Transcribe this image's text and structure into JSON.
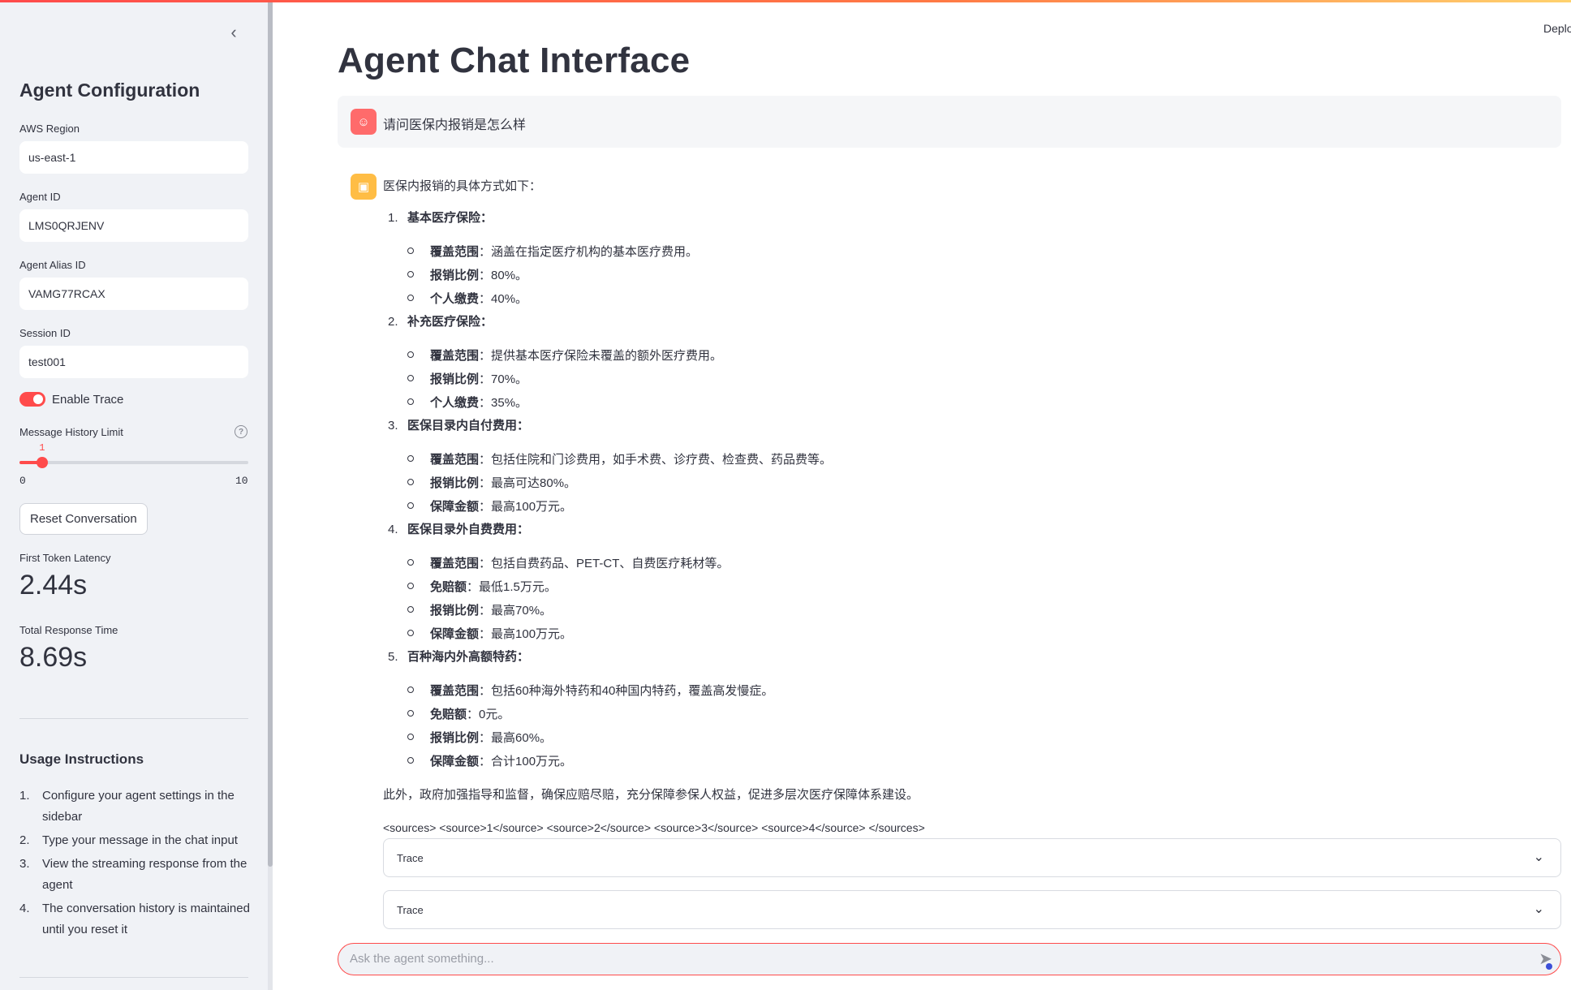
{
  "header": {
    "deploy_label": "Deplo"
  },
  "sidebar": {
    "collapse_icon": "chevron-left-icon",
    "title": "Agent Configuration",
    "fields": [
      {
        "label": "AWS Region",
        "value": "us-east-1"
      },
      {
        "label": "Agent ID",
        "value": "LMS0QRJENV"
      },
      {
        "label": "Agent Alias ID",
        "value": "VAMG77RCAX"
      },
      {
        "label": "Session ID",
        "value": "test001"
      }
    ],
    "enable_trace": {
      "label": "Enable Trace",
      "on": true
    },
    "history_slider": {
      "label": "Message History Limit",
      "value": "1",
      "min": "0",
      "max": "10",
      "fraction": 0.1
    },
    "reset_button": "Reset Conversation",
    "metrics": [
      {
        "label": "First Token Latency",
        "value": "2.44s"
      },
      {
        "label": "Total Response Time",
        "value": "8.69s"
      }
    ],
    "usage_title": "Usage Instructions",
    "usage_items": [
      {
        "num": "1.",
        "text": "Configure your agent settings in the sidebar"
      },
      {
        "num": "2.",
        "text": "Type your message in the chat input"
      },
      {
        "num": "3.",
        "text": "View the streaming response from the agent"
      },
      {
        "num": "4.",
        "text": "The conversation history is maintained until you reset it"
      }
    ]
  },
  "main": {
    "title": "Agent Chat Interface",
    "user_message": "请问医保内报销是怎么样",
    "assistant": {
      "intro": "医保内报销的具体方式如下：",
      "sections": [
        {
          "num": "1.",
          "title": "基本医疗保险：",
          "items": [
            {
              "k": "覆盖范围",
              "v": "：涵盖在指定医疗机构的基本医疗费用。"
            },
            {
              "k": "报销比例",
              "v": "：80%。"
            },
            {
              "k": "个人缴费",
              "v": "：40%。"
            }
          ]
        },
        {
          "num": "2.",
          "title": "补充医疗保险：",
          "items": [
            {
              "k": "覆盖范围",
              "v": "：提供基本医疗保险未覆盖的额外医疗费用。"
            },
            {
              "k": "报销比例",
              "v": "：70%。"
            },
            {
              "k": "个人缴费",
              "v": "：35%。"
            }
          ]
        },
        {
          "num": "3.",
          "title": "医保目录内自付费用：",
          "items": [
            {
              "k": "覆盖范围",
              "v": "：包括住院和门诊费用，如手术费、诊疗费、检查费、药品费等。"
            },
            {
              "k": "报销比例",
              "v": "：最高可达80%。"
            },
            {
              "k": "保障金额",
              "v": "：最高100万元。"
            }
          ]
        },
        {
          "num": "4.",
          "title": "医保目录外自费费用：",
          "items": [
            {
              "k": "覆盖范围",
              "v": "：包括自费药品、PET-CT、自费医疗耗材等。"
            },
            {
              "k": "免赔额",
              "v": "：最低1.5万元。"
            },
            {
              "k": "报销比例",
              "v": "：最高70%。"
            },
            {
              "k": "保障金额",
              "v": "：最高100万元。"
            }
          ]
        },
        {
          "num": "5.",
          "title": "百种海内外高额特药：",
          "items": [
            {
              "k": "覆盖范围",
              "v": "：包括60种海外特药和40种国内特药，覆盖高发慢症。"
            },
            {
              "k": "免赔额",
              "v": "：0元。"
            },
            {
              "k": "报销比例",
              "v": "：最高60%。"
            },
            {
              "k": "保障金额",
              "v": "：合计100万元。"
            }
          ]
        }
      ],
      "closing": "此外，政府加强指导和监督，确保应赔尽赔，充分保障参保人权益，促进多层次医疗保障体系建设。",
      "sources": "<sources> <source>1</source> <source>2</source> <source>3</source> <source>4</source> </sources>"
    },
    "expanders": [
      {
        "label": "Trace"
      },
      {
        "label": "Trace"
      }
    ],
    "chat_input": {
      "placeholder": "Ask the agent something...",
      "value": ""
    }
  }
}
